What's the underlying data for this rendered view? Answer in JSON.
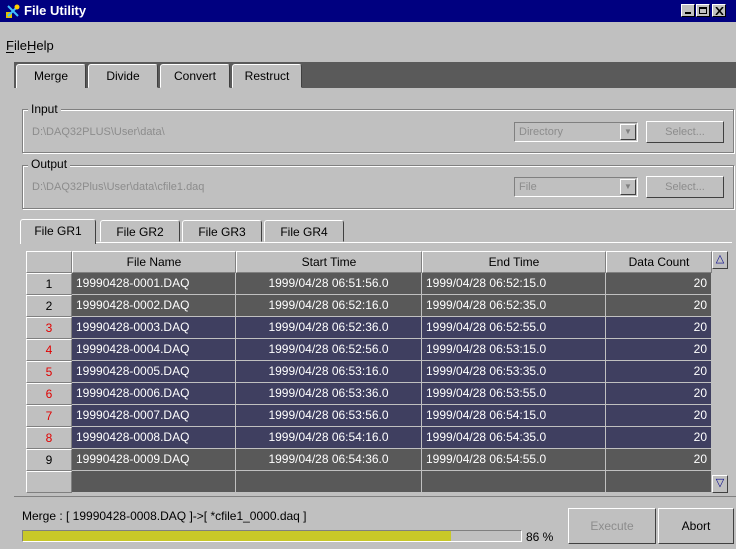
{
  "window": {
    "title": "File Utility"
  },
  "menu": {
    "items": [
      "File",
      "Help"
    ]
  },
  "tabs": [
    "Merge",
    "Divide",
    "Convert",
    "Restruct"
  ],
  "input": {
    "label": "Input",
    "path": "D:\\DAQ32PLUS\\User\\data\\",
    "type": "Directory",
    "select_label": "Select..."
  },
  "output": {
    "label": "Output",
    "path": "D:\\DAQ32Plus\\User\\data\\cfile1.daq",
    "type": "File",
    "select_label": "Select..."
  },
  "groups": [
    "File GR1",
    "File GR2",
    "File GR3",
    "File GR4"
  ],
  "table": {
    "headers": [
      "File Name",
      "Start Time",
      "End Time",
      "Data Count"
    ],
    "rows": [
      {
        "num": "1",
        "name": "19990428-0001.DAQ",
        "start": "1999/04/28 06:51:56.0",
        "end": "1999/04/28 06:52:15.0",
        "count": "20",
        "num_color": "#000000"
      },
      {
        "num": "2",
        "name": "19990428-0002.DAQ",
        "start": "1999/04/28 06:52:16.0",
        "end": "1999/04/28 06:52:35.0",
        "count": "20",
        "num_color": "#000000"
      },
      {
        "num": "3",
        "name": "19990428-0003.DAQ",
        "start": "1999/04/28 06:52:36.0",
        "end": "1999/04/28 06:52:55.0",
        "count": "20",
        "num_color": "#e00000"
      },
      {
        "num": "4",
        "name": "19990428-0004.DAQ",
        "start": "1999/04/28 06:52:56.0",
        "end": "1999/04/28 06:53:15.0",
        "count": "20",
        "num_color": "#e00000"
      },
      {
        "num": "5",
        "name": "19990428-0005.DAQ",
        "start": "1999/04/28 06:53:16.0",
        "end": "1999/04/28 06:53:35.0",
        "count": "20",
        "num_color": "#e00000"
      },
      {
        "num": "6",
        "name": "19990428-0006.DAQ",
        "start": "1999/04/28 06:53:36.0",
        "end": "1999/04/28 06:53:55.0",
        "count": "20",
        "num_color": "#e00000"
      },
      {
        "num": "7",
        "name": "19990428-0007.DAQ",
        "start": "1999/04/28 06:53:56.0",
        "end": "1999/04/28 06:54:15.0",
        "count": "20",
        "num_color": "#e00000"
      },
      {
        "num": "8",
        "name": "19990428-0008.DAQ",
        "start": "1999/04/28 06:54:16.0",
        "end": "1999/04/28 06:54:35.0",
        "count": "20",
        "num_color": "#e00000"
      },
      {
        "num": "9",
        "name": "19990428-0009.DAQ",
        "start": "1999/04/28 06:54:36.0",
        "end": "1999/04/28 06:54:55.0",
        "count": "20",
        "num_color": "#000000"
      }
    ]
  },
  "status": {
    "message": "Merge : [ 19990428-0008.DAQ ]->[ *cfile1_0000.daq ]",
    "progress_percent": 86,
    "progress_label": "86 %",
    "execute_label": "Execute",
    "abort_label": "Abort"
  },
  "colors": {
    "title_bar": "#000080",
    "progress": "#c8c828",
    "selected_row": "#3f3f60",
    "row": "#595959"
  },
  "icons": {
    "app": "tool-icon",
    "minimize": "minimize-icon",
    "maximize": "maximize-icon",
    "close": "close-icon"
  }
}
